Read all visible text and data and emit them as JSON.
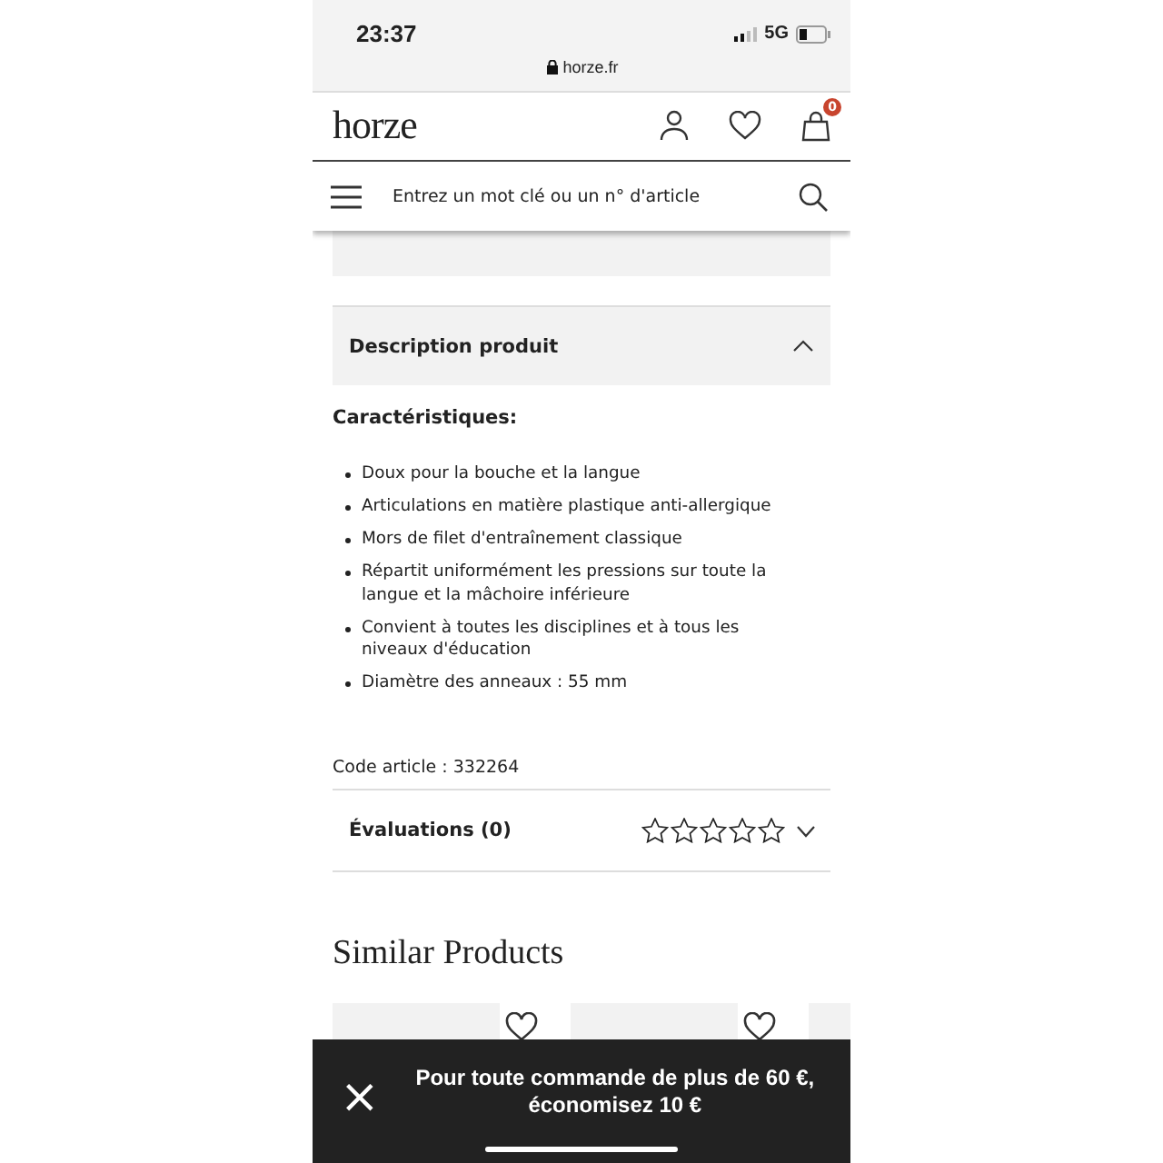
{
  "status_bar": {
    "time": "23:37",
    "network": "5G",
    "url": "horze.fr"
  },
  "header": {
    "logo": "horze",
    "cart_count": "0"
  },
  "search": {
    "placeholder": "Entrez un mot clé ou un n° d'article"
  },
  "description": {
    "title": "Description produit",
    "expanded": true,
    "heading": "Caractéristiques:",
    "bullets": [
      "Doux pour la bouche et la langue",
      "Articulations en matière plastique anti-allergique",
      "Mors de filet d'entraînement classique",
      "Répartit uniformément les pressions sur toute la langue et la mâchoire inférieure",
      "Convient à toutes les disciplines et à tous les niveaux d'éducation",
      "Diamètre des anneaux : 55 mm"
    ],
    "code": "Code article : 332264"
  },
  "reviews": {
    "title": "Évaluations (0)",
    "stars": 0
  },
  "similar": {
    "title": "Similar Products",
    "cards": [
      {
        "kind": "product"
      },
      {
        "kind": "product"
      },
      {
        "kind": "partial"
      }
    ]
  },
  "banner": {
    "close": "×",
    "text": "Pour toute commande de plus de 60 €, économisez 10 €"
  }
}
